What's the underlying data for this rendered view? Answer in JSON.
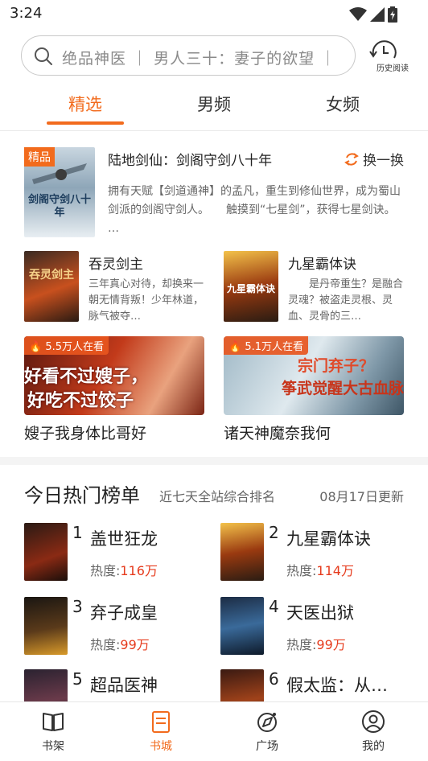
{
  "status": {
    "time": "3:24"
  },
  "search": {
    "placeholder": "绝品神医 ｜ 男人三十：妻子的欲望 ｜",
    "history_label": "历史阅读"
  },
  "tabs": [
    {
      "label": "精选",
      "active": true
    },
    {
      "label": "男频",
      "active": false
    },
    {
      "label": "女频",
      "active": false
    }
  ],
  "feature": {
    "badge": "精品",
    "title": "陆地剑仙：剑阁守剑八十年",
    "refresh_label": "换一换",
    "description": "拥有天赋【剑道通神】的孟凡，重生到修仙世界，成为蜀山剑派的剑阁守剑人。　　触摸到“七星剑”，获得七星剑诀。 …",
    "cover_text": "剑阁守剑八十年"
  },
  "mini_books": [
    {
      "title": "吞灵剑主",
      "desc": "三年真心对待，却换来一朝无情背叛！少年林道，脉气被夺…",
      "cover_text": "吞灵剑主"
    },
    {
      "title": "九星霸体诀",
      "desc": "　　是丹帝重生？是融合灵魂？被盗走灵根、灵血、灵骨的三…",
      "cover_text": "九星霸体诀"
    }
  ],
  "banners": [
    {
      "views": "5.5万人在看",
      "overlay_text_1": "好看不过嫂子，",
      "overlay_text_2": "好吃不过饺子",
      "caption": "嫂子我身体比哥好"
    },
    {
      "views": "5.1万人在看",
      "overlay_text_1": "宗门弃子？",
      "overlay_text_2": "筝武觉醒大古血脉",
      "caption": "诸天神魔奈我何"
    }
  ],
  "ranking": {
    "title": "今日热门榜单",
    "subtitle": "近七天全站综合排名",
    "updated": "08月17日更新",
    "heat_label": "热度:",
    "items": [
      {
        "rank": "1",
        "name": "盖世狂龙",
        "heat": "116万"
      },
      {
        "rank": "2",
        "name": "九星霸体诀",
        "heat": "114万"
      },
      {
        "rank": "3",
        "name": "弃子成皇",
        "heat": "99万"
      },
      {
        "rank": "4",
        "name": "天医出狱",
        "heat": "99万"
      },
      {
        "rank": "5",
        "name": "超品医神",
        "heat": ""
      },
      {
        "rank": "6",
        "name": "假太监：从…",
        "heat": ""
      }
    ]
  },
  "bottom_nav": [
    {
      "label": "书架",
      "icon": "book-icon",
      "active": false
    },
    {
      "label": "书城",
      "icon": "store-icon",
      "active": true
    },
    {
      "label": "广场",
      "icon": "plaza-icon",
      "active": false
    },
    {
      "label": "我的",
      "icon": "profile-icon",
      "active": false
    }
  ],
  "colors": {
    "accent": "#f26b1d",
    "heat": "#e63b1d"
  }
}
